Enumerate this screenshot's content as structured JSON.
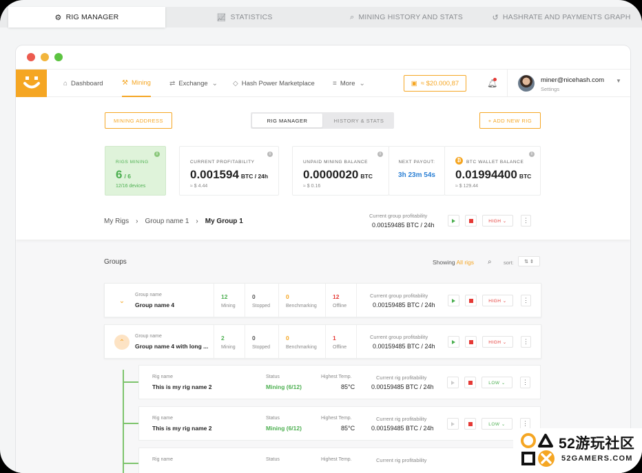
{
  "top_tabs": [
    {
      "label": "RIG MANAGER",
      "icon": "gear-icon",
      "active": true
    },
    {
      "label": "STATISTICS",
      "icon": "chart-icon",
      "active": false
    },
    {
      "label": "MINING HISTORY AND STATS",
      "icon": "search-icon",
      "active": false
    },
    {
      "label": "HASHRATE AND PAYMENTS GRAPH",
      "icon": "history-icon",
      "active": false
    }
  ],
  "colors": {
    "accent": "#f5a623",
    "green": "#4caf50",
    "red": "#e53935",
    "window_dot_red": "#ec5b4f",
    "window_dot_yellow": "#f2b53c",
    "window_dot_green": "#5cc341"
  },
  "nav": {
    "items": [
      {
        "label": "Dashboard",
        "icon": "home-icon"
      },
      {
        "label": "Mining",
        "icon": "pickaxe-icon"
      },
      {
        "label": "Exchange",
        "icon": "exchange-icon"
      },
      {
        "label": "Hash Power Marketplace",
        "icon": "tag-icon"
      },
      {
        "label": "More",
        "icon": "menu-icon"
      }
    ],
    "balance": "≈ $20.000,87",
    "user_email": "miner@nicehash.com",
    "user_sub": "Settings"
  },
  "toolbar": {
    "mining_address": "MINING ADDRESS",
    "seg_rig_manager": "RIG MANAGER",
    "seg_history": "HISTORY & STATS",
    "add_rig": "+ ADD NEW RIG"
  },
  "cards": {
    "rigs": {
      "label": "RIGS MINING",
      "value": "6",
      "total": "/ 6",
      "sub": "12/16 devices"
    },
    "profit": {
      "label": "CURRENT PROFITABILITY",
      "value": "0.001594",
      "unit": "BTC  / 24h",
      "sub": "≈ $ 4.44"
    },
    "unpaid": {
      "label": "UNPAID MINING BALANCE",
      "value": "0.0000020",
      "unit": "BTC",
      "sub": "≈ $ 0.16"
    },
    "payout": {
      "label": "NEXT PAYOUT:",
      "value": "3h 23m 54s"
    },
    "wallet": {
      "label": "BTC WALLET BALANCE",
      "value": "0.01994400",
      "unit": "BTC",
      "sub": "≈ $ 129.44"
    }
  },
  "breadcrumb": {
    "root": "My Rigs",
    "sep": "›",
    "mid": "Group name 1",
    "current": "My Group 1"
  },
  "group_profit": {
    "label": "Current group profitability",
    "value": "0.00159485 BTC / 24h",
    "power": "HIGH ⌄"
  },
  "groups_header": {
    "title": "Groups",
    "showing": "Showing",
    "filter": "All rigs",
    "sort": "sort:",
    "sort_icon": "⇅  ⇕"
  },
  "groups": [
    {
      "label": "Group name",
      "name": "Group name 4",
      "mining": "12",
      "stopped": "0",
      "bench": "0",
      "offline": "12",
      "mining_l": "Mining",
      "stopped_l": "Stopped",
      "bench_l": "Benchmarking",
      "offline_l": "Offline",
      "profit_l": "Current group profitability",
      "profit": "0.00159485 BTC / 24h",
      "power": "HIGH ⌄"
    },
    {
      "label": "Group name",
      "name": "Group name 4 with long ...",
      "mining": "2",
      "stopped": "0",
      "bench": "0",
      "offline": "1",
      "mining_l": "Mining",
      "stopped_l": "Stopped",
      "bench_l": "Benchmarking",
      "offline_l": "Offline",
      "profit_l": "Current group profitability",
      "profit": "0.00159485 BTC / 24h",
      "power": "HIGH ⌄"
    }
  ],
  "rigs": [
    {
      "label": "Rig name",
      "name": "This is my rig name 2",
      "status_l": "Status",
      "status": "Mining (6/12)",
      "temp_l": "Highest Temp.",
      "temp": "85°C",
      "profit_l": "Current rig profitability",
      "profit": "0.00159485 BTC / 24h",
      "power": "LOW ⌄"
    },
    {
      "label": "Rig name",
      "name": "This is my rig name 2",
      "status_l": "Status",
      "status": "Mining (6/12)",
      "temp_l": "Highest Temp.",
      "temp": "85°C",
      "profit_l": "Current rig profitability",
      "profit": "0.00159485 BTC / 24h",
      "power": "LOW ⌄"
    },
    {
      "label": "Rig name",
      "status_l": "Status",
      "temp_l": "Highest Temp.",
      "profit_l": "Current rig profitability"
    }
  ],
  "brand": {
    "name": "52游玩社区",
    "sub": "52GAMERS.COM"
  }
}
